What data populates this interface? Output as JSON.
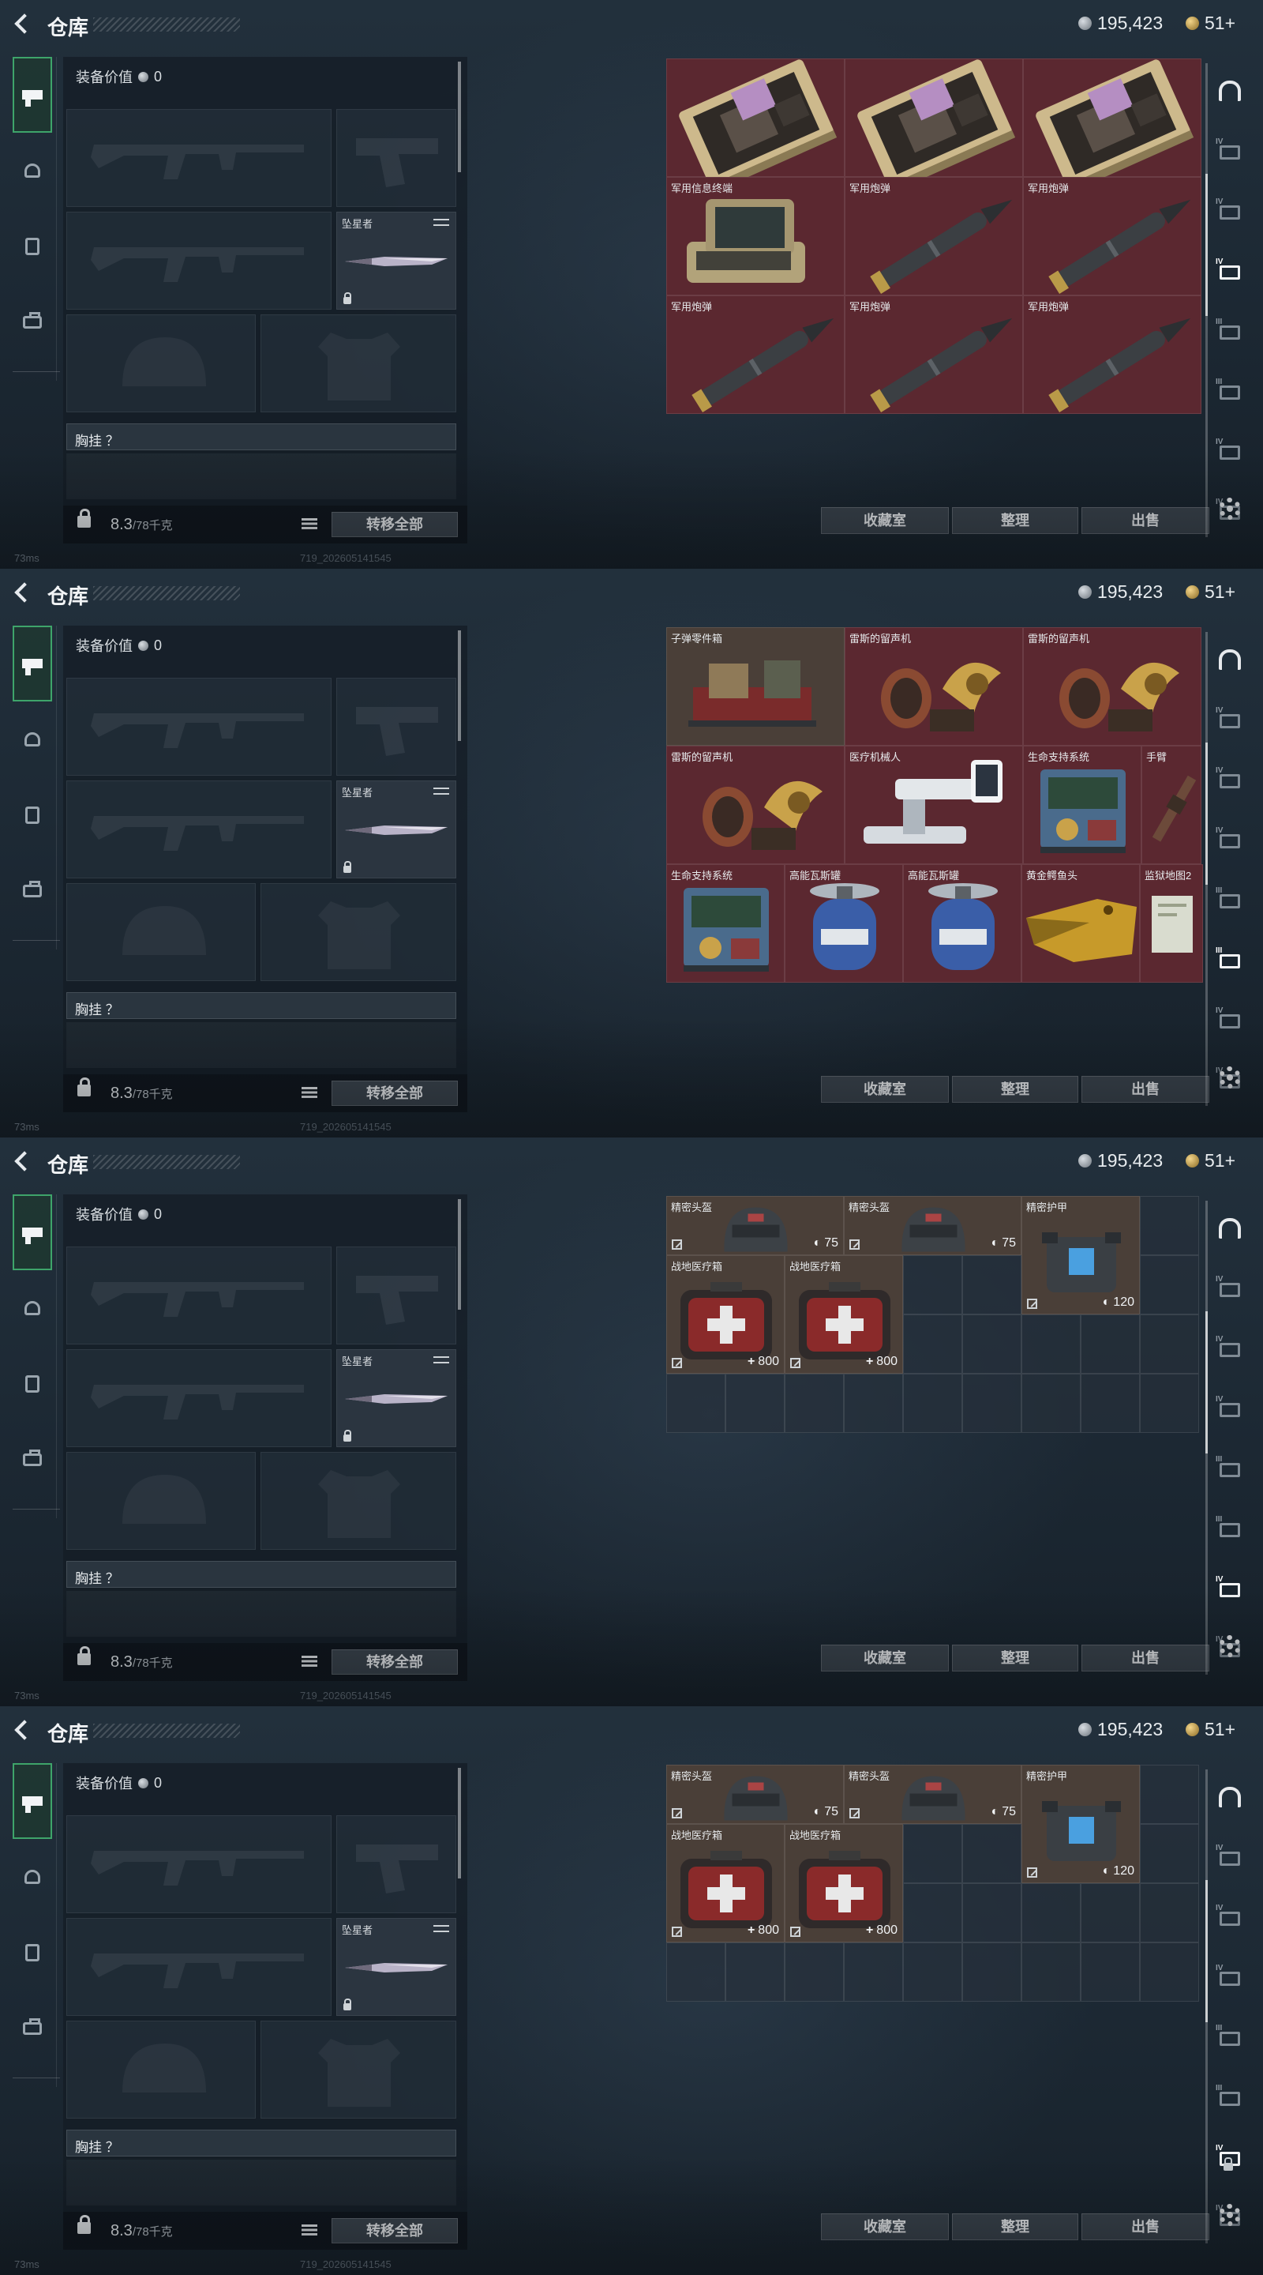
{
  "header": {
    "title": "仓库",
    "coins": "195,423",
    "gold": "51+"
  },
  "status": {
    "ping": "73ms",
    "build": "719_202605141545"
  },
  "loadout": {
    "equip_value_label": "装备价值",
    "equip_value": "0",
    "melee_label": "坠星者",
    "chest_label": "胸挂 ？",
    "weight": "8.3",
    "weight_max": "/78千克",
    "transfer_all": "转移全部"
  },
  "actions": {
    "collection": "收藏室",
    "sort": "整理",
    "sell": "出售"
  },
  "panels": [
    {
      "active_tier": "IV",
      "items": [
        {
          "name": "",
          "type": "card",
          "bg": "red"
        },
        {
          "name": "",
          "type": "card",
          "bg": "red"
        },
        {
          "name": "",
          "type": "card",
          "bg": "red"
        },
        {
          "name": "军用信息终端",
          "type": "terminal",
          "bg": "red"
        },
        {
          "name": "军用炮弹",
          "type": "shell",
          "bg": "red"
        },
        {
          "name": "军用炮弹",
          "type": "shell",
          "bg": "red"
        },
        {
          "name": "军用炮弹",
          "type": "shell",
          "bg": "red"
        },
        {
          "name": "军用炮弹",
          "type": "shell",
          "bg": "red"
        },
        {
          "name": "军用炮弹",
          "type": "shell",
          "bg": "red"
        }
      ]
    },
    {
      "active_tier": "III",
      "items": [
        {
          "name": "子弹零件箱",
          "type": "crate",
          "bg": "brown"
        },
        {
          "name": "雷斯的留声机",
          "type": "gramophone",
          "bg": "red"
        },
        {
          "name": "雷斯的留声机",
          "type": "gramophone",
          "bg": "red"
        },
        {
          "name": "雷斯的留声机",
          "type": "gramophone",
          "bg": "red"
        },
        {
          "name": "医疗机械人",
          "type": "robot",
          "bg": "red"
        },
        {
          "name": "生命支持系统",
          "type": "lifesupport",
          "bg": "red"
        },
        {
          "name": "手臂",
          "type": "arm",
          "bg": "red"
        },
        {
          "name": "生命支持系统",
          "type": "lifesupport",
          "bg": "red"
        },
        {
          "name": "高能瓦斯罐",
          "type": "tank",
          "bg": "red"
        },
        {
          "name": "高能瓦斯罐",
          "type": "tank",
          "bg": "red"
        },
        {
          "name": "黄金鳄鱼头",
          "type": "croc",
          "bg": "red"
        },
        {
          "name": "监狱地图2",
          "type": "map",
          "bg": "red"
        }
      ]
    },
    {
      "active_tier": "",
      "items": [
        {
          "name": "精密头盔",
          "stat": "75",
          "stat_icon": "shield",
          "type": "helmet"
        },
        {
          "name": "精密头盔",
          "stat": "75",
          "stat_icon": "shield",
          "type": "helmet"
        },
        {
          "name": "精密护甲",
          "stat": "120",
          "stat_icon": "shield",
          "type": "armor"
        },
        {
          "name": "战地医疗箱",
          "stat": "800",
          "stat_icon": "plus",
          "type": "medkit"
        },
        {
          "name": "战地医疗箱",
          "stat": "800",
          "stat_icon": "plus",
          "type": "medkit"
        }
      ]
    },
    {
      "active_tier": "",
      "items": [
        {
          "name": "精密头盔",
          "stat": "75",
          "stat_icon": "shield",
          "type": "helmet"
        },
        {
          "name": "精密头盔",
          "stat": "75",
          "stat_icon": "shield",
          "type": "helmet"
        },
        {
          "name": "精密护甲",
          "stat": "120",
          "stat_icon": "shield",
          "type": "armor"
        },
        {
          "name": "战地医疗箱",
          "stat": "800",
          "stat_icon": "plus",
          "type": "medkit"
        },
        {
          "name": "战地医疗箱",
          "stat": "800",
          "stat_icon": "plus",
          "type": "medkit"
        }
      ]
    }
  ],
  "rail_tiers": [
    "",
    "IV",
    "IV",
    "IV",
    "III",
    "III",
    "IV",
    "IV"
  ],
  "colors": {
    "accent_green": "#3ea46a",
    "item_red": "#5b2830",
    "item_brown": "#4a3f38"
  }
}
